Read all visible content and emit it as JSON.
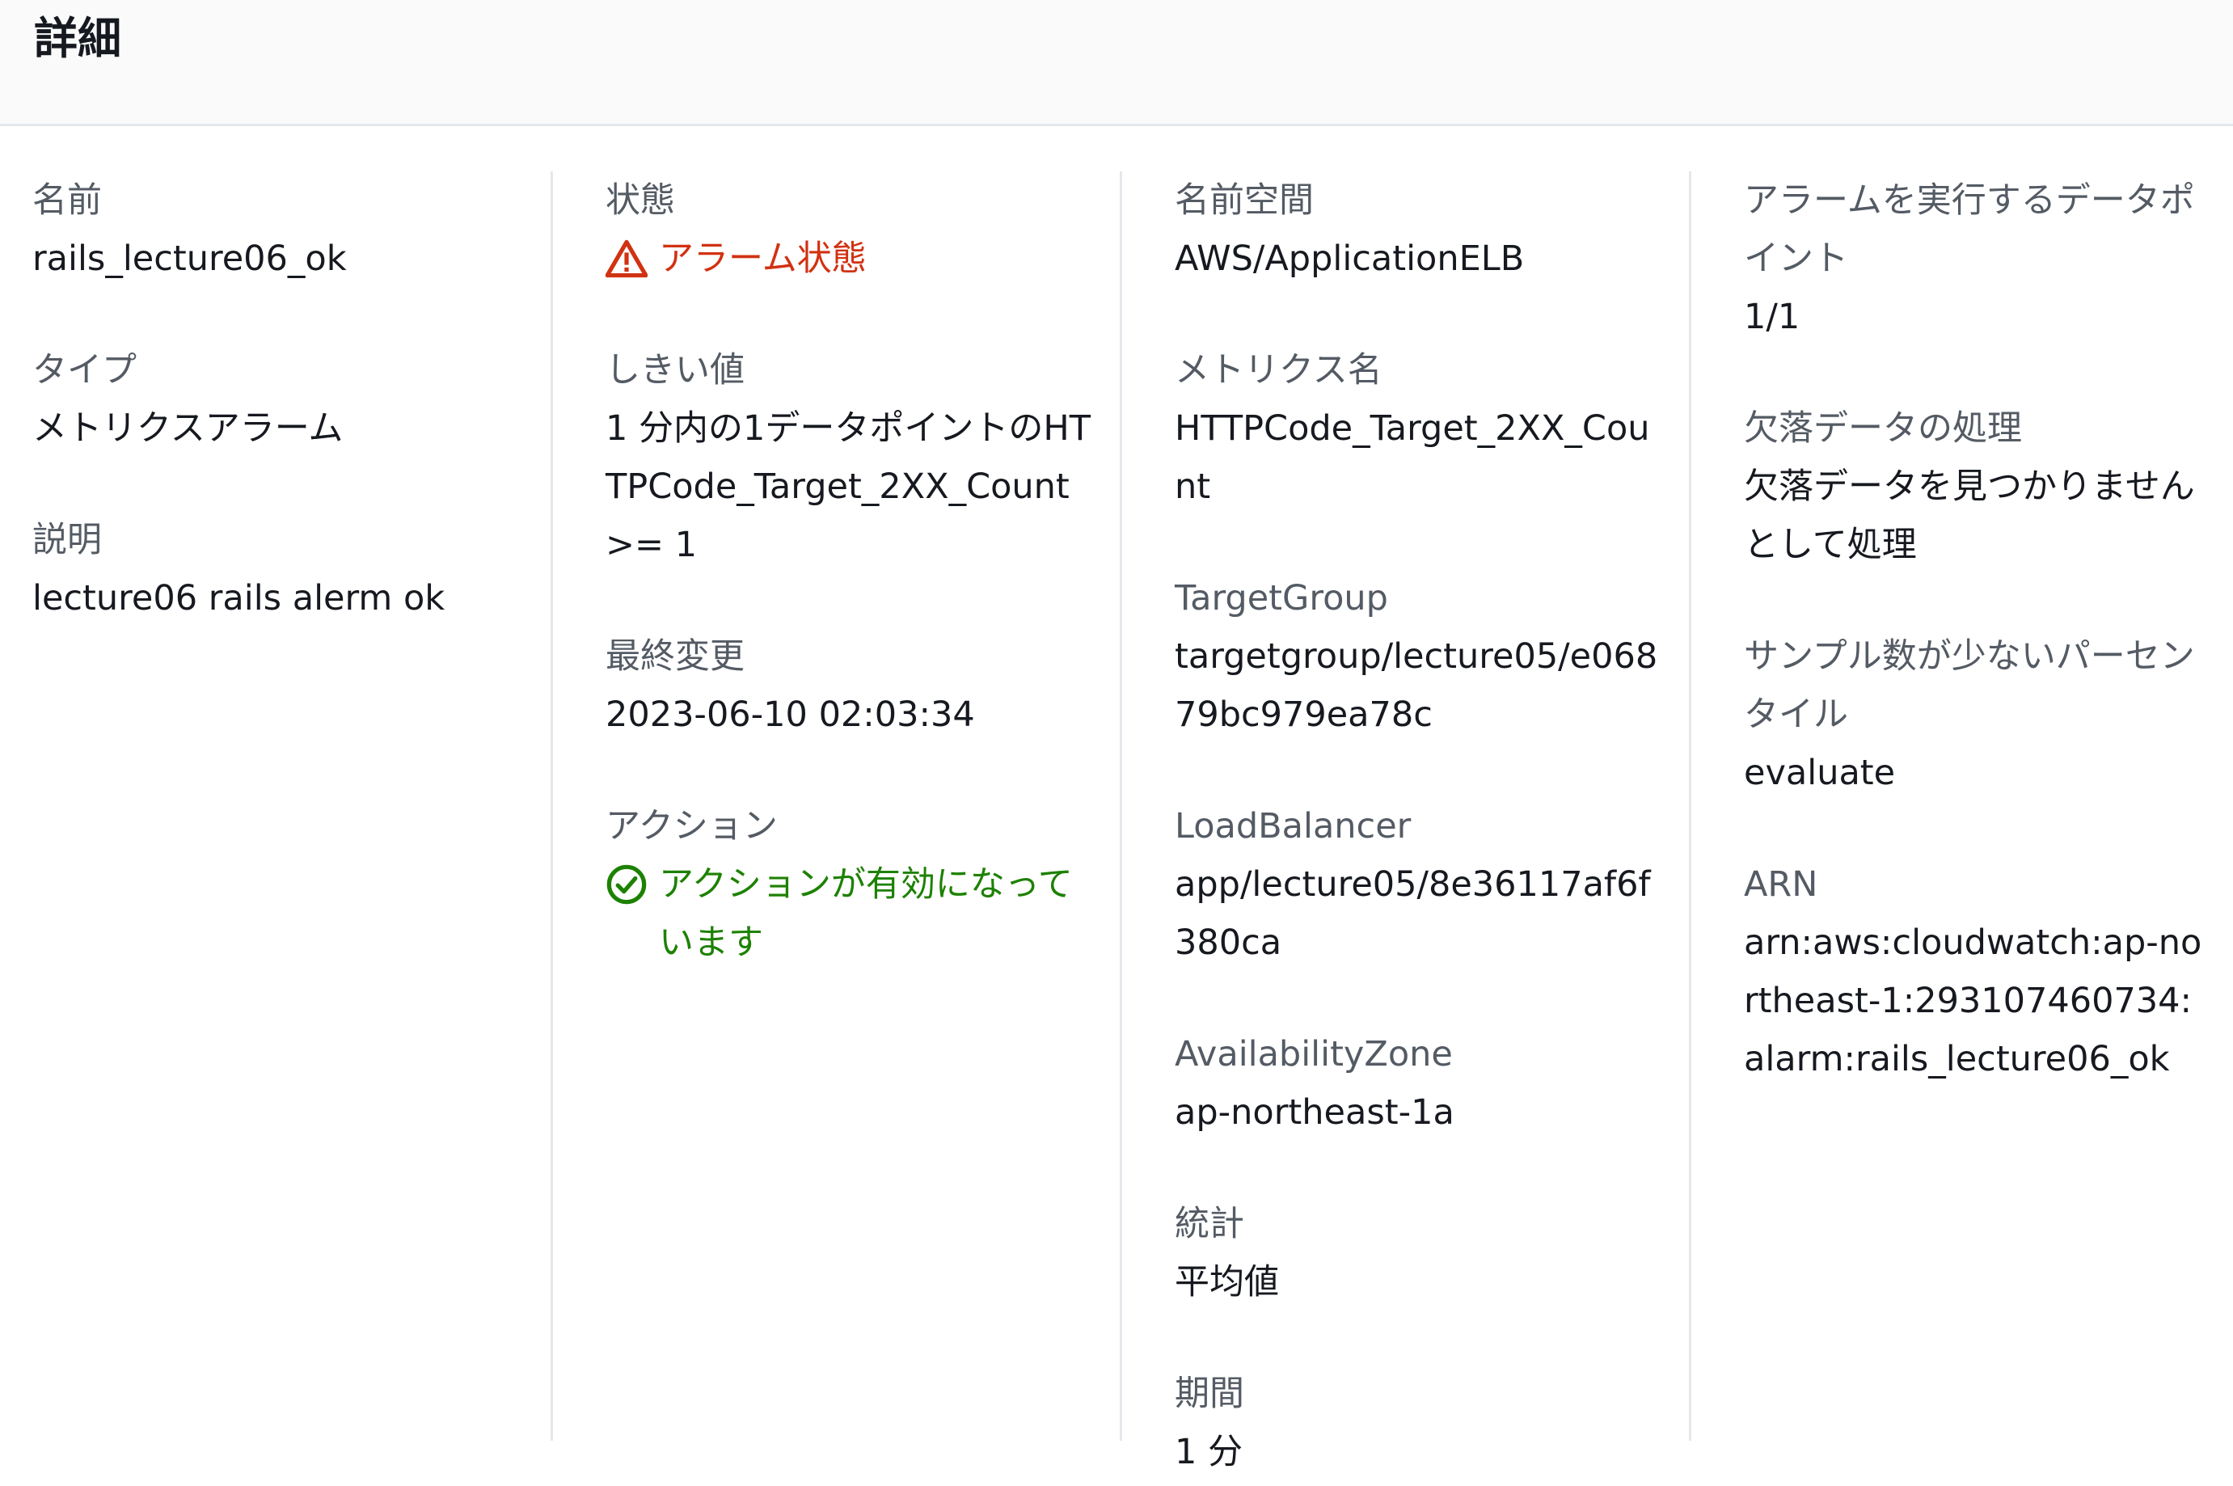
{
  "header": {
    "title": "詳細"
  },
  "fields": {
    "name": {
      "label": "名前",
      "value": "rails_lecture06_ok"
    },
    "type": {
      "label": "タイプ",
      "value": "メトリクスアラーム"
    },
    "description": {
      "label": "説明",
      "value": "lecture06 rails alerm ok"
    },
    "state": {
      "label": "状態",
      "value": "アラーム状態"
    },
    "threshold": {
      "label": "しきい値",
      "value": "1 分内の1データポイントのHTTPCode_Target_2XX_Count >= 1"
    },
    "last_change": {
      "label": "最終変更",
      "value": "2023-06-10 02:03:34"
    },
    "actions": {
      "label": "アクション",
      "value": "アクションが有効になっています"
    },
    "namespace": {
      "label": "名前空間",
      "value": "AWS/ApplicationELB"
    },
    "metric_name": {
      "label": "メトリクス名",
      "value": "HTTPCode_Target_2XX_Count"
    },
    "target_group": {
      "label": "TargetGroup",
      "value": "targetgroup/lecture05/e06879bc979ea78c"
    },
    "load_balancer": {
      "label": "LoadBalancer",
      "value": "app/lecture05/8e36117af6f380ca"
    },
    "availability_zone": {
      "label": "AvailabilityZone",
      "value": "ap-northeast-1a"
    },
    "statistic": {
      "label": "統計",
      "value": "平均値"
    },
    "period": {
      "label": "期間",
      "value": "1 分"
    },
    "datapoints_to_alarm": {
      "label": "アラームを実行するデータポイント",
      "value": "1/1"
    },
    "missing_data": {
      "label": "欠落データの処理",
      "value": "欠落データを見つかりませんとして処理"
    },
    "low_sample_percentiles": {
      "label": "サンプル数が少ないパーセンタイル",
      "value": "evaluate"
    },
    "arn": {
      "label": "ARN",
      "value": "arn:aws:cloudwatch:ap-northeast-1:293107460734:alarm:rails_lecture06_ok"
    }
  },
  "colors": {
    "alarm": "#d13212",
    "ok": "#1d8102",
    "label": "#545b64",
    "text": "#16191f"
  },
  "icons": {
    "alarm": "warning-triangle-icon",
    "ok": "check-circle-icon"
  }
}
